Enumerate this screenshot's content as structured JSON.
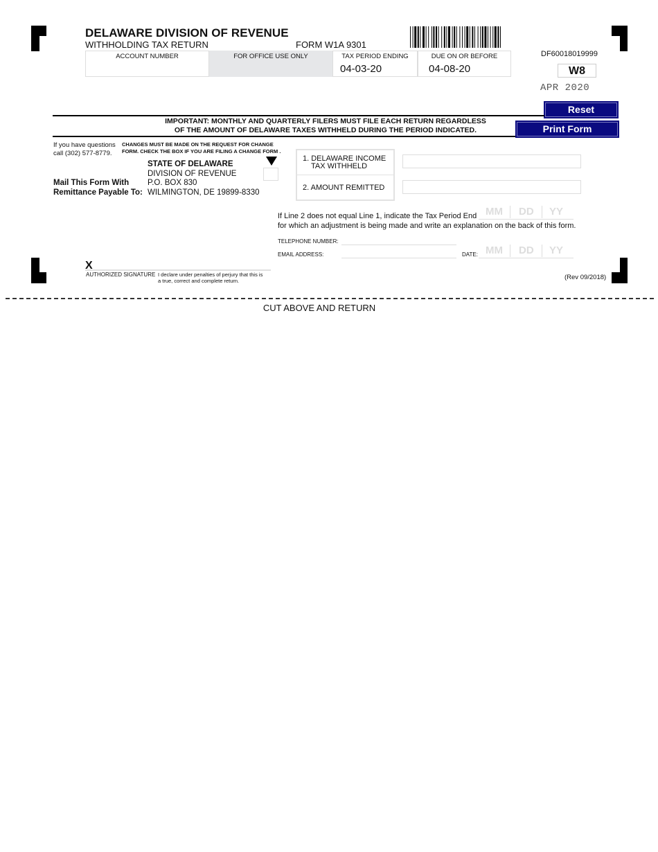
{
  "header": {
    "title": "DELAWARE DIVISION OF REVENUE",
    "subtitle": "WITHHOLDING TAX RETURN",
    "form_number": "FORM W1A 9301",
    "document_id": "DF60018019999",
    "form_code": "W8",
    "period_label": "APR 2020"
  },
  "header_boxes": {
    "account_number": {
      "label": "ACCOUNT NUMBER",
      "value": ""
    },
    "office_use": {
      "label": "FOR OFFICE USE ONLY"
    },
    "tax_period_ending": {
      "label": "TAX PERIOD ENDING",
      "value": "04-03-20"
    },
    "due_on_or_before": {
      "label": "DUE ON OR BEFORE",
      "value": "04-08-20"
    }
  },
  "buttons": {
    "reset": "Reset",
    "print": "Print Form"
  },
  "notice": {
    "line1": "IMPORTANT: MONTHLY AND QUARTERLY FILERS MUST FILE EACH RETURN REGARDLESS",
    "line2": "OF THE AMOUNT OF DELAWARE TAXES WITHHELD DURING THE PERIOD INDICATED."
  },
  "questions": {
    "line1": "If you have questions",
    "line2": "call (302) 577-8779."
  },
  "change_notice": {
    "line1": "CHANGES MUST BE MADE ON THE REQUEST FOR CHANGE",
    "line2": "FORM. CHECK THE BOX IF YOU ARE FILING A CHANGE FORM ."
  },
  "mail": {
    "label_line1": "Mail This Form With",
    "label_line2": "Remittance Payable To:",
    "address": [
      "STATE OF DELAWARE",
      "DIVISION OF REVENUE",
      "P.O. BOX 830",
      "WILMINGTON, DE 19899-8330"
    ]
  },
  "lines": [
    {
      "label_line1": "1. DELAWARE INCOME",
      "label_line2": "TAX WITHHELD",
      "value": ""
    },
    {
      "label_line1": "2. AMOUNT REMITTED",
      "label_line2": "",
      "value": ""
    }
  ],
  "adjustment": {
    "line1": "If Line 2 does not equal Line 1, indicate the Tax Period End",
    "line2": "for which an adjustment is being made and write an explanation on the back of this form.",
    "placeholders": [
      "MM",
      "DD",
      "YY"
    ]
  },
  "contact": {
    "telephone_label": "TELEPHONE NUMBER:",
    "telephone_value": "",
    "email_label": "EMAIL ADDRESS:",
    "email_value": "",
    "date_label": "DATE:",
    "date_placeholders": [
      "MM",
      "DD",
      "YY"
    ]
  },
  "signature": {
    "mark": "X",
    "label": "AUTHORIZED SIGNATURE",
    "declaration_line1": "I declare under penalties of perjury that this is",
    "declaration_line2": "a true, correct and complete return."
  },
  "revision": "(Rev 09/2018)",
  "cut_label": "CUT ABOVE AND RETURN"
}
